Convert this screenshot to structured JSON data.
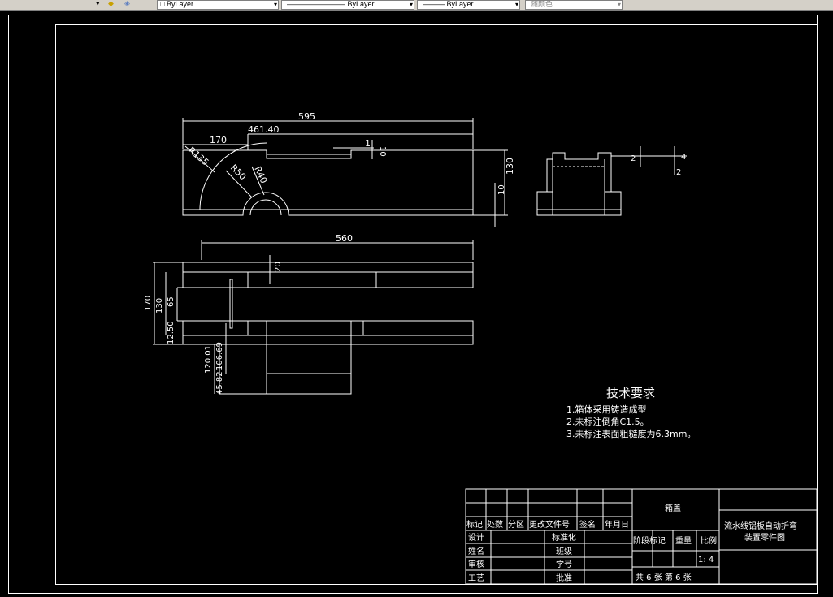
{
  "toolbar": {
    "layer_control": "ByLayer",
    "linetype_control": "ByLayer",
    "lineweight_control": "ByLayer",
    "color_control": "随颜色"
  },
  "drawing": {
    "dims": {
      "top_width": "595",
      "dim_461": "461.40",
      "dim_170_top": "170",
      "r135": "R135",
      "r50": "R50",
      "r40": "R40",
      "dim_1": "1",
      "dim_10_small": "10",
      "dim_130": "130",
      "dim_10_right": "10",
      "side_2a": "2",
      "side_4": "4",
      "side_2b": "2",
      "plan_width": "560",
      "dim_20": "20",
      "dim_170_left": "170",
      "dim_130_left": "130",
      "dim_65": "65",
      "dim_12_50": "12.50",
      "dim_120_01": "120.01",
      "dim_106_69": "106.69",
      "dim_45_82": "45.82"
    },
    "tech": {
      "title": "技术要求",
      "line1": "1.箱体采用铸造成型",
      "line2": "2.未标注倒角C1.5。",
      "line3": "3.未标注表面粗糙度为6.3mm。"
    },
    "title_block": {
      "h_mark": "标记",
      "h_count": "处数",
      "h_zone": "分区",
      "h_change": "更改文件号",
      "h_sign": "签名",
      "h_date": "年月日",
      "design": "设计",
      "standard": "标准化",
      "name": "姓名",
      "class": "班级",
      "review": "审核",
      "student_id": "学号",
      "craft": "工艺",
      "approve": "批准",
      "part_name": "箱盖",
      "stage": "阶段标记",
      "weight": "重量",
      "scale": "比例",
      "scale_value": "1: 4",
      "sheets": "共 6 张  第 6 张",
      "drawing_title_1": "流水线铝板自动折弯",
      "drawing_title_2": "装置零件图"
    }
  }
}
